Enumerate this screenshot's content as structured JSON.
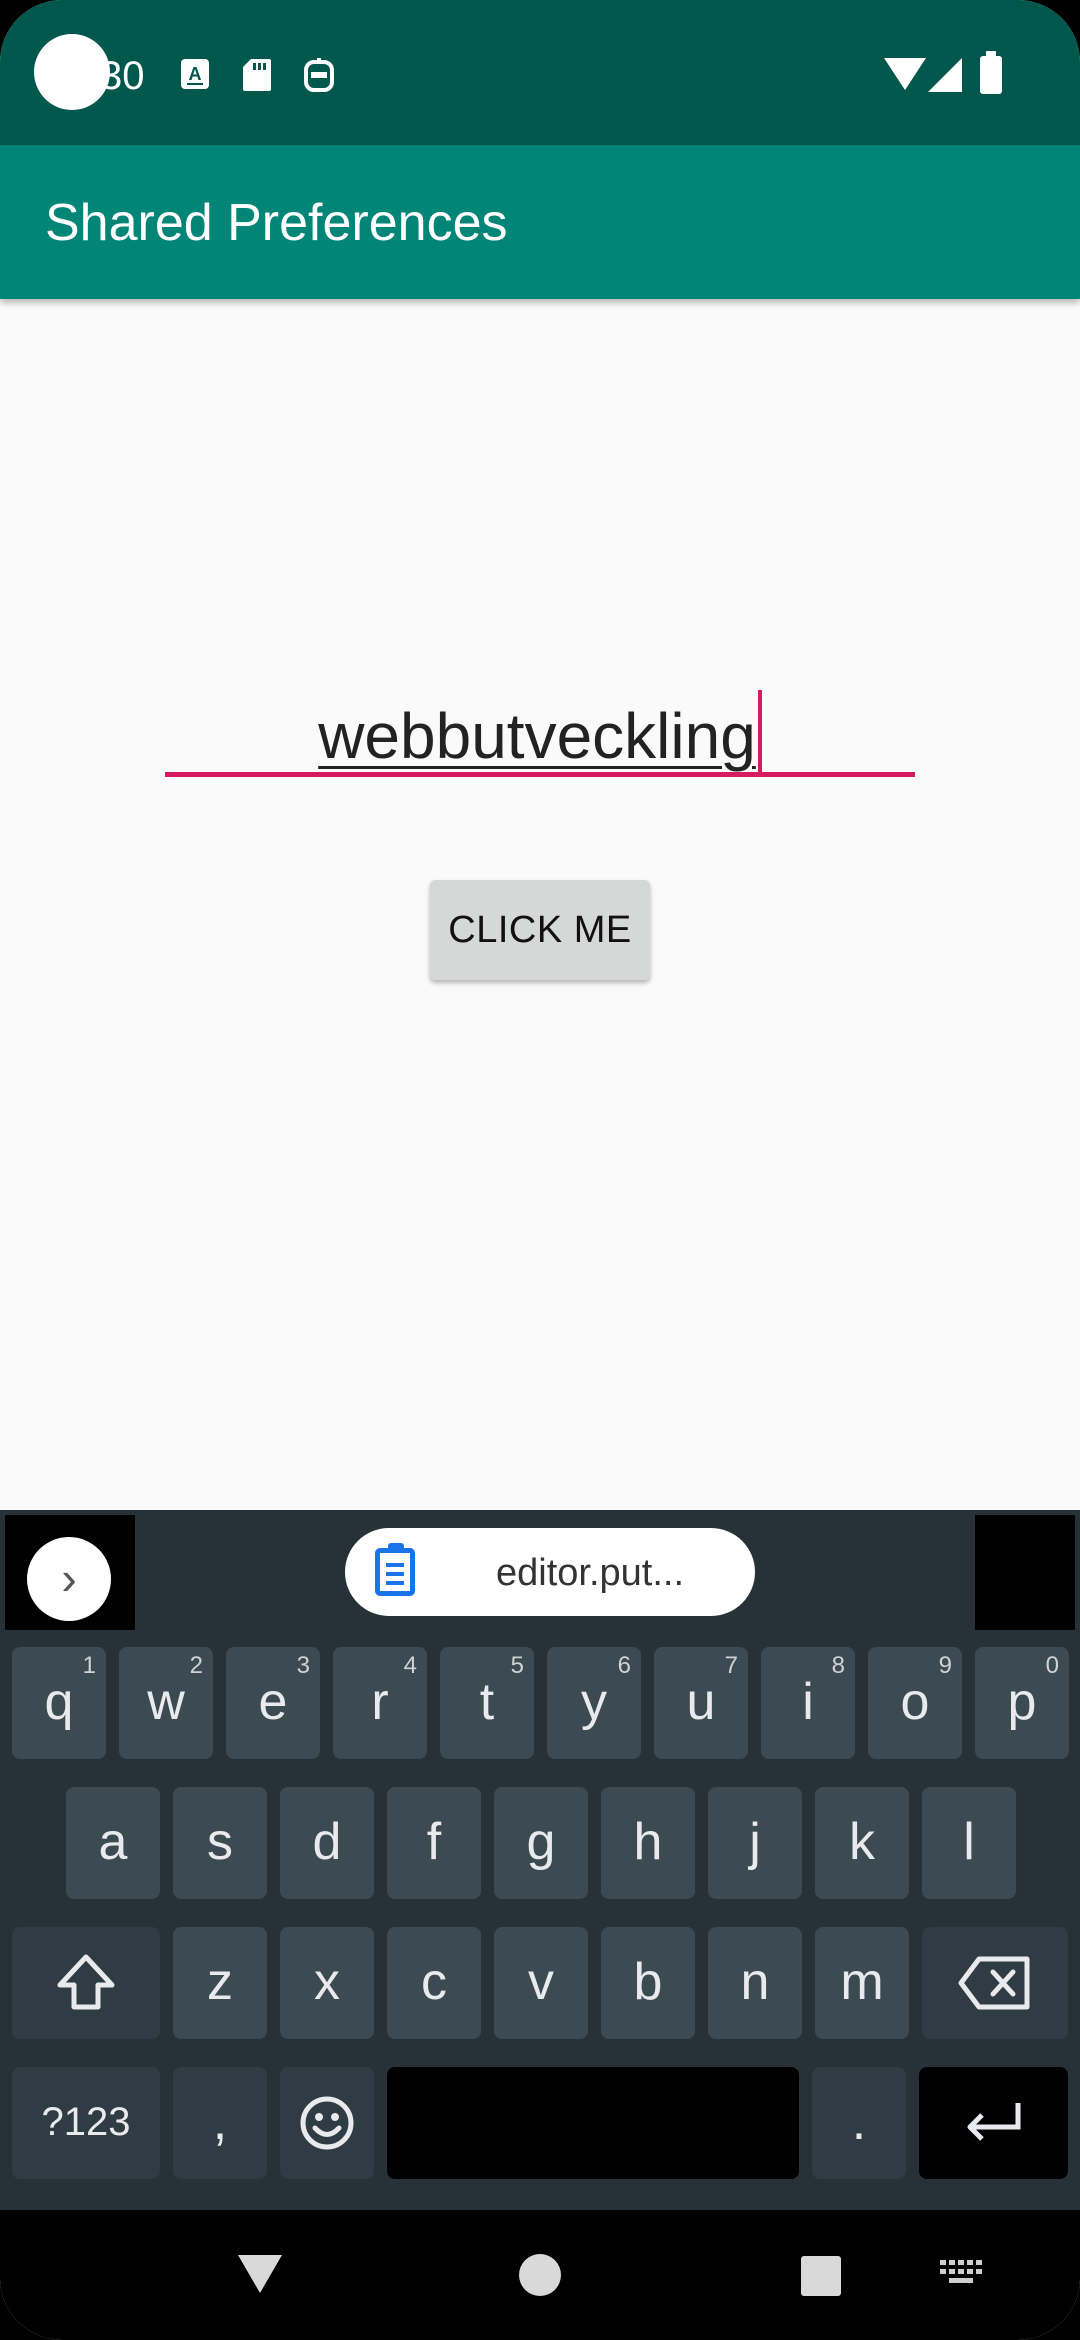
{
  "status_bar": {
    "time": "30",
    "icons": [
      "notification-a-icon",
      "sd-card-icon",
      "app-icon",
      "wifi-icon",
      "signal-icon",
      "battery-icon"
    ]
  },
  "app_bar": {
    "title": "Shared Preferences"
  },
  "main": {
    "input_value": "webbutveckling",
    "button_label": "CLICK ME"
  },
  "keyboard": {
    "clipboard_suggestion": "editor.put...",
    "row1": [
      {
        "key": "q",
        "hint": "1"
      },
      {
        "key": "w",
        "hint": "2"
      },
      {
        "key": "e",
        "hint": "3"
      },
      {
        "key": "r",
        "hint": "4"
      },
      {
        "key": "t",
        "hint": "5"
      },
      {
        "key": "y",
        "hint": "6"
      },
      {
        "key": "u",
        "hint": "7"
      },
      {
        "key": "i",
        "hint": "8"
      },
      {
        "key": "o",
        "hint": "9"
      },
      {
        "key": "p",
        "hint": "0"
      }
    ],
    "row2": [
      "a",
      "s",
      "d",
      "f",
      "g",
      "h",
      "j",
      "k",
      "l"
    ],
    "row3": [
      "z",
      "x",
      "c",
      "v",
      "b",
      "n",
      "m"
    ],
    "symbols_label": "?123",
    "comma": ",",
    "period": "."
  },
  "colors": {
    "status_bar": "#00574b",
    "app_bar": "#008577",
    "accent": "#d81b60",
    "keyboard": "#263238"
  }
}
